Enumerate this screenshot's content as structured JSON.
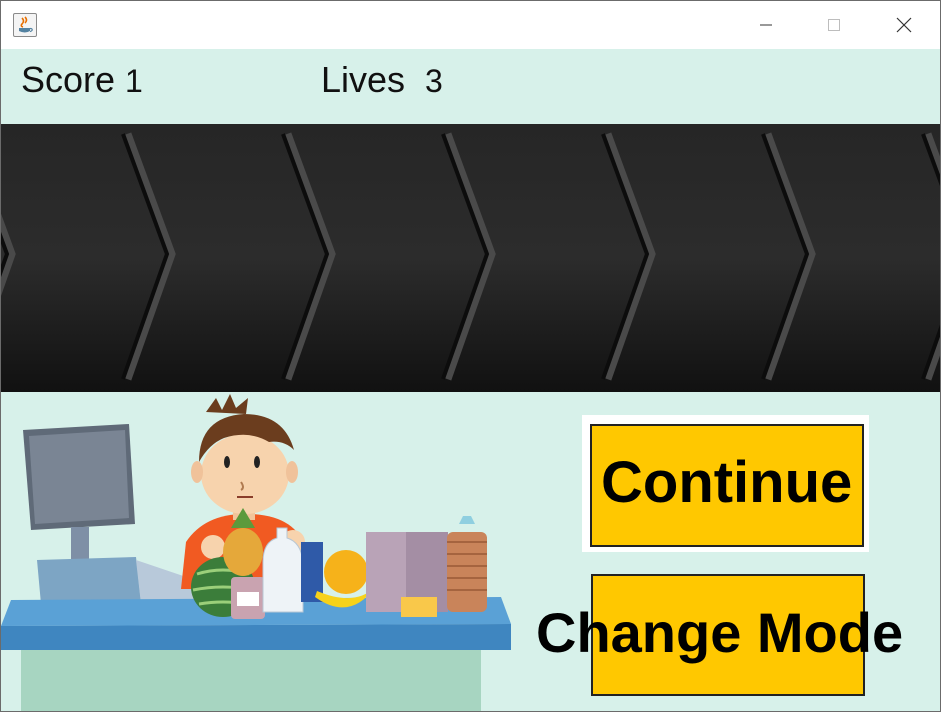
{
  "window": {
    "title": ""
  },
  "hud": {
    "score_label": "Score",
    "score_value": "1",
    "lives_label": "Lives",
    "lives_value": "3"
  },
  "buttons": {
    "continue_label": "Continue",
    "change_mode_label": "Change Mode"
  },
  "colors": {
    "background": "#d7f1ea",
    "button": "#ffc800",
    "belt": "#1e1e1e",
    "counter": "#6aaed9"
  },
  "icons": {
    "app": "java-icon",
    "minimize": "minimize-icon",
    "maximize": "maximize-icon",
    "close": "close-icon"
  }
}
